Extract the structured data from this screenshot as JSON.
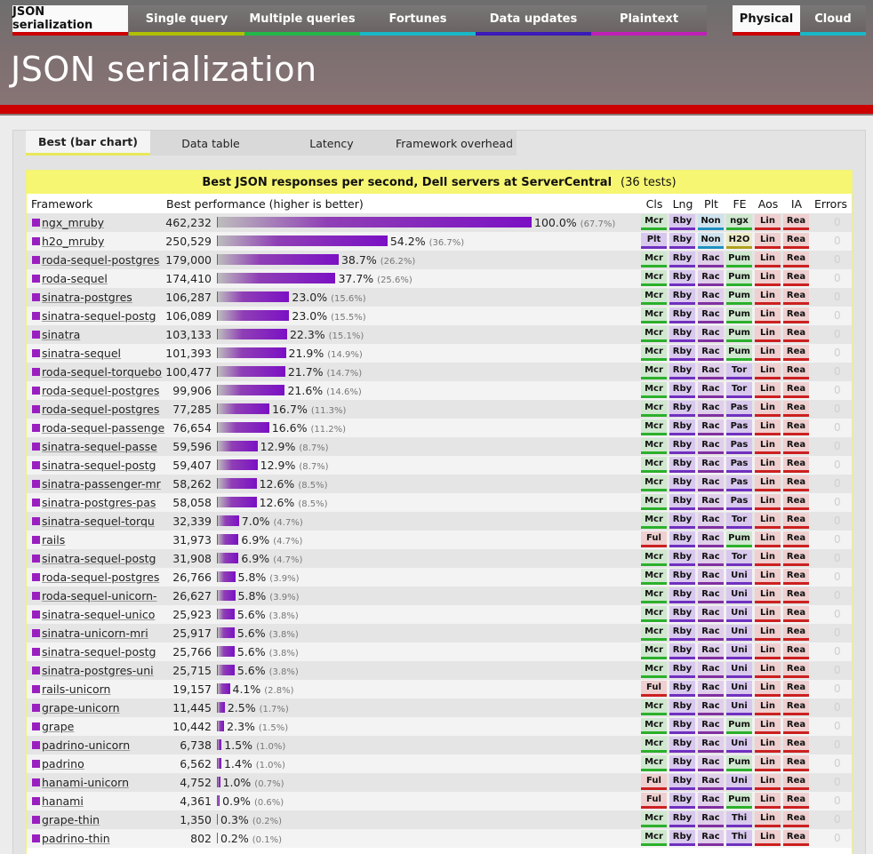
{
  "test_tabs": [
    {
      "label": "JSON serialization",
      "color": "#cc0000",
      "active": true
    },
    {
      "label": "Single query",
      "color": "#b0c000",
      "active": false
    },
    {
      "label": "Multiple queries",
      "color": "#22b84a",
      "active": false
    },
    {
      "label": "Fortunes",
      "color": "#18b8c8",
      "active": false
    },
    {
      "label": "Data updates",
      "color": "#3a1ab8",
      "active": false
    },
    {
      "label": "Plaintext",
      "color": "#c020b8",
      "active": false
    }
  ],
  "env_tabs": [
    {
      "label": "Physical",
      "color": "#cc0000",
      "active": true
    },
    {
      "label": "Cloud",
      "color": "#18b8c8",
      "active": false
    }
  ],
  "page_title": "JSON serialization",
  "view_tabs": [
    {
      "label": "Best (bar chart)",
      "active": true
    },
    {
      "label": "Data table",
      "active": false
    },
    {
      "label": "Latency",
      "active": false
    },
    {
      "label": "Framework overhead",
      "active": false
    }
  ],
  "chart_title": "Best JSON responses per second, Dell servers at ServerCentral",
  "chart_count": "(36 tests)",
  "columns": {
    "framework": "Framework",
    "performance": "Best performance (higher is better)",
    "attrs": [
      "Cls",
      "Lng",
      "Plt",
      "FE",
      "Aos",
      "IA"
    ],
    "errors": "Errors"
  },
  "attr_colors": {
    "Mcr": {
      "bg": "#cfe8cf",
      "border": "#2bb02b"
    },
    "Ful": {
      "bg": "#efcfcf",
      "border": "#cc2020"
    },
    "Plt": {
      "bg": "#d8c8ee",
      "border": "#7030c0"
    },
    "Rby": {
      "bg": "#d8c8ee",
      "border": "#7030c0"
    },
    "Non": {
      "bg": "#cfe2ee",
      "border": "#2090c0"
    },
    "Rac": {
      "bg": "#e0cfea",
      "border": "#8030a0"
    },
    "ngx": {
      "bg": "#cfe8cf",
      "border": "#2bb02b"
    },
    "H2O": {
      "bg": "#ecebc8",
      "border": "#b0a020"
    },
    "Pum": {
      "bg": "#cfe8cf",
      "border": "#2bb02b"
    },
    "Tor": {
      "bg": "#d8c8ee",
      "border": "#7030c0"
    },
    "Pas": {
      "bg": "#d8c8ee",
      "border": "#7030c0"
    },
    "Uni": {
      "bg": "#d8c8ee",
      "border": "#7030c0"
    },
    "Thi": {
      "bg": "#d8c8ee",
      "border": "#7030c0"
    },
    "Lin": {
      "bg": "#efcfcf",
      "border": "#cc2020"
    },
    "Rea": {
      "bg": "#efcfcf",
      "border": "#cc2020"
    }
  },
  "rows": [
    {
      "fw": "ngx_mruby",
      "rps": "462,232",
      "pct": 100.0,
      "pct_label": "100.0%",
      "rel": "(67.7%)",
      "attrs": [
        "Mcr",
        "Rby",
        "Non",
        "ngx",
        "Lin",
        "Rea"
      ],
      "errors": "0"
    },
    {
      "fw": "h2o_mruby",
      "rps": "250,529",
      "pct": 54.2,
      "pct_label": "54.2%",
      "rel": "(36.7%)",
      "attrs": [
        "Plt",
        "Rby",
        "Non",
        "H2O",
        "Lin",
        "Rea"
      ],
      "errors": "0"
    },
    {
      "fw": "roda-sequel-postgres",
      "rps": "179,000",
      "pct": 38.7,
      "pct_label": "38.7%",
      "rel": "(26.2%)",
      "attrs": [
        "Mcr",
        "Rby",
        "Rac",
        "Pum",
        "Lin",
        "Rea"
      ],
      "errors": "0"
    },
    {
      "fw": "roda-sequel",
      "rps": "174,410",
      "pct": 37.7,
      "pct_label": "37.7%",
      "rel": "(25.6%)",
      "attrs": [
        "Mcr",
        "Rby",
        "Rac",
        "Pum",
        "Lin",
        "Rea"
      ],
      "errors": "0"
    },
    {
      "fw": "sinatra-postgres",
      "rps": "106,287",
      "pct": 23.0,
      "pct_label": "23.0%",
      "rel": "(15.6%)",
      "attrs": [
        "Mcr",
        "Rby",
        "Rac",
        "Pum",
        "Lin",
        "Rea"
      ],
      "errors": "0"
    },
    {
      "fw": "sinatra-sequel-postg",
      "rps": "106,089",
      "pct": 23.0,
      "pct_label": "23.0%",
      "rel": "(15.5%)",
      "attrs": [
        "Mcr",
        "Rby",
        "Rac",
        "Pum",
        "Lin",
        "Rea"
      ],
      "errors": "0"
    },
    {
      "fw": "sinatra",
      "rps": "103,133",
      "pct": 22.3,
      "pct_label": "22.3%",
      "rel": "(15.1%)",
      "attrs": [
        "Mcr",
        "Rby",
        "Rac",
        "Pum",
        "Lin",
        "Rea"
      ],
      "errors": "0"
    },
    {
      "fw": "sinatra-sequel",
      "rps": "101,393",
      "pct": 21.9,
      "pct_label": "21.9%",
      "rel": "(14.9%)",
      "attrs": [
        "Mcr",
        "Rby",
        "Rac",
        "Pum",
        "Lin",
        "Rea"
      ],
      "errors": "0"
    },
    {
      "fw": "roda-sequel-torquebo",
      "rps": "100,477",
      "pct": 21.7,
      "pct_label": "21.7%",
      "rel": "(14.7%)",
      "attrs": [
        "Mcr",
        "Rby",
        "Rac",
        "Tor",
        "Lin",
        "Rea"
      ],
      "errors": "0"
    },
    {
      "fw": "roda-sequel-postgres",
      "rps": "99,906",
      "pct": 21.6,
      "pct_label": "21.6%",
      "rel": "(14.6%)",
      "attrs": [
        "Mcr",
        "Rby",
        "Rac",
        "Tor",
        "Lin",
        "Rea"
      ],
      "errors": "0"
    },
    {
      "fw": "roda-sequel-postgres",
      "rps": "77,285",
      "pct": 16.7,
      "pct_label": "16.7%",
      "rel": "(11.3%)",
      "attrs": [
        "Mcr",
        "Rby",
        "Rac",
        "Pas",
        "Lin",
        "Rea"
      ],
      "errors": "0"
    },
    {
      "fw": "roda-sequel-passenge",
      "rps": "76,654",
      "pct": 16.6,
      "pct_label": "16.6%",
      "rel": "(11.2%)",
      "attrs": [
        "Mcr",
        "Rby",
        "Rac",
        "Pas",
        "Lin",
        "Rea"
      ],
      "errors": "0"
    },
    {
      "fw": "sinatra-sequel-passe",
      "rps": "59,596",
      "pct": 12.9,
      "pct_label": "12.9%",
      "rel": "(8.7%)",
      "attrs": [
        "Mcr",
        "Rby",
        "Rac",
        "Pas",
        "Lin",
        "Rea"
      ],
      "errors": "0"
    },
    {
      "fw": "sinatra-sequel-postg",
      "rps": "59,407",
      "pct": 12.9,
      "pct_label": "12.9%",
      "rel": "(8.7%)",
      "attrs": [
        "Mcr",
        "Rby",
        "Rac",
        "Pas",
        "Lin",
        "Rea"
      ],
      "errors": "0"
    },
    {
      "fw": "sinatra-passenger-mr",
      "rps": "58,262",
      "pct": 12.6,
      "pct_label": "12.6%",
      "rel": "(8.5%)",
      "attrs": [
        "Mcr",
        "Rby",
        "Rac",
        "Pas",
        "Lin",
        "Rea"
      ],
      "errors": "0"
    },
    {
      "fw": "sinatra-postgres-pas",
      "rps": "58,058",
      "pct": 12.6,
      "pct_label": "12.6%",
      "rel": "(8.5%)",
      "attrs": [
        "Mcr",
        "Rby",
        "Rac",
        "Pas",
        "Lin",
        "Rea"
      ],
      "errors": "0"
    },
    {
      "fw": "sinatra-sequel-torqu",
      "rps": "32,339",
      "pct": 7.0,
      "pct_label": "7.0%",
      "rel": "(4.7%)",
      "attrs": [
        "Mcr",
        "Rby",
        "Rac",
        "Tor",
        "Lin",
        "Rea"
      ],
      "errors": "0"
    },
    {
      "fw": "rails",
      "rps": "31,973",
      "pct": 6.9,
      "pct_label": "6.9%",
      "rel": "(4.7%)",
      "attrs": [
        "Ful",
        "Rby",
        "Rac",
        "Pum",
        "Lin",
        "Rea"
      ],
      "errors": "0"
    },
    {
      "fw": "sinatra-sequel-postg",
      "rps": "31,908",
      "pct": 6.9,
      "pct_label": "6.9%",
      "rel": "(4.7%)",
      "attrs": [
        "Mcr",
        "Rby",
        "Rac",
        "Tor",
        "Lin",
        "Rea"
      ],
      "errors": "0"
    },
    {
      "fw": "roda-sequel-postgres",
      "rps": "26,766",
      "pct": 5.8,
      "pct_label": "5.8%",
      "rel": "(3.9%)",
      "attrs": [
        "Mcr",
        "Rby",
        "Rac",
        "Uni",
        "Lin",
        "Rea"
      ],
      "errors": "0"
    },
    {
      "fw": "roda-sequel-unicorn-",
      "rps": "26,627",
      "pct": 5.8,
      "pct_label": "5.8%",
      "rel": "(3.9%)",
      "attrs": [
        "Mcr",
        "Rby",
        "Rac",
        "Uni",
        "Lin",
        "Rea"
      ],
      "errors": "0"
    },
    {
      "fw": "sinatra-sequel-unico",
      "rps": "25,923",
      "pct": 5.6,
      "pct_label": "5.6%",
      "rel": "(3.8%)",
      "attrs": [
        "Mcr",
        "Rby",
        "Rac",
        "Uni",
        "Lin",
        "Rea"
      ],
      "errors": "0"
    },
    {
      "fw": "sinatra-unicorn-mri",
      "rps": "25,917",
      "pct": 5.6,
      "pct_label": "5.6%",
      "rel": "(3.8%)",
      "attrs": [
        "Mcr",
        "Rby",
        "Rac",
        "Uni",
        "Lin",
        "Rea"
      ],
      "errors": "0"
    },
    {
      "fw": "sinatra-sequel-postg",
      "rps": "25,766",
      "pct": 5.6,
      "pct_label": "5.6%",
      "rel": "(3.8%)",
      "attrs": [
        "Mcr",
        "Rby",
        "Rac",
        "Uni",
        "Lin",
        "Rea"
      ],
      "errors": "0"
    },
    {
      "fw": "sinatra-postgres-uni",
      "rps": "25,715",
      "pct": 5.6,
      "pct_label": "5.6%",
      "rel": "(3.8%)",
      "attrs": [
        "Mcr",
        "Rby",
        "Rac",
        "Uni",
        "Lin",
        "Rea"
      ],
      "errors": "0"
    },
    {
      "fw": "rails-unicorn",
      "rps": "19,157",
      "pct": 4.1,
      "pct_label": "4.1%",
      "rel": "(2.8%)",
      "attrs": [
        "Ful",
        "Rby",
        "Rac",
        "Uni",
        "Lin",
        "Rea"
      ],
      "errors": "0"
    },
    {
      "fw": "grape-unicorn",
      "rps": "11,445",
      "pct": 2.5,
      "pct_label": "2.5%",
      "rel": "(1.7%)",
      "attrs": [
        "Mcr",
        "Rby",
        "Rac",
        "Uni",
        "Lin",
        "Rea"
      ],
      "errors": "0"
    },
    {
      "fw": "grape",
      "rps": "10,442",
      "pct": 2.3,
      "pct_label": "2.3%",
      "rel": "(1.5%)",
      "attrs": [
        "Mcr",
        "Rby",
        "Rac",
        "Pum",
        "Lin",
        "Rea"
      ],
      "errors": "0"
    },
    {
      "fw": "padrino-unicorn",
      "rps": "6,738",
      "pct": 1.5,
      "pct_label": "1.5%",
      "rel": "(1.0%)",
      "attrs": [
        "Mcr",
        "Rby",
        "Rac",
        "Uni",
        "Lin",
        "Rea"
      ],
      "errors": "0"
    },
    {
      "fw": "padrino",
      "rps": "6,562",
      "pct": 1.4,
      "pct_label": "1.4%",
      "rel": "(1.0%)",
      "attrs": [
        "Mcr",
        "Rby",
        "Rac",
        "Pum",
        "Lin",
        "Rea"
      ],
      "errors": "0"
    },
    {
      "fw": "hanami-unicorn",
      "rps": "4,752",
      "pct": 1.0,
      "pct_label": "1.0%",
      "rel": "(0.7%)",
      "attrs": [
        "Ful",
        "Rby",
        "Rac",
        "Uni",
        "Lin",
        "Rea"
      ],
      "errors": "0"
    },
    {
      "fw": "hanami",
      "rps": "4,361",
      "pct": 0.9,
      "pct_label": "0.9%",
      "rel": "(0.6%)",
      "attrs": [
        "Ful",
        "Rby",
        "Rac",
        "Pum",
        "Lin",
        "Rea"
      ],
      "errors": "0"
    },
    {
      "fw": "grape-thin",
      "rps": "1,350",
      "pct": 0.3,
      "pct_label": "0.3%",
      "rel": "(0.2%)",
      "attrs": [
        "Mcr",
        "Rby",
        "Rac",
        "Thi",
        "Lin",
        "Rea"
      ],
      "errors": "0"
    },
    {
      "fw": "padrino-thin",
      "rps": "802",
      "pct": 0.2,
      "pct_label": "0.2%",
      "rel": "(0.1%)",
      "attrs": [
        "Mcr",
        "Rby",
        "Rac",
        "Thi",
        "Lin",
        "Rea"
      ],
      "errors": "0"
    }
  ]
}
